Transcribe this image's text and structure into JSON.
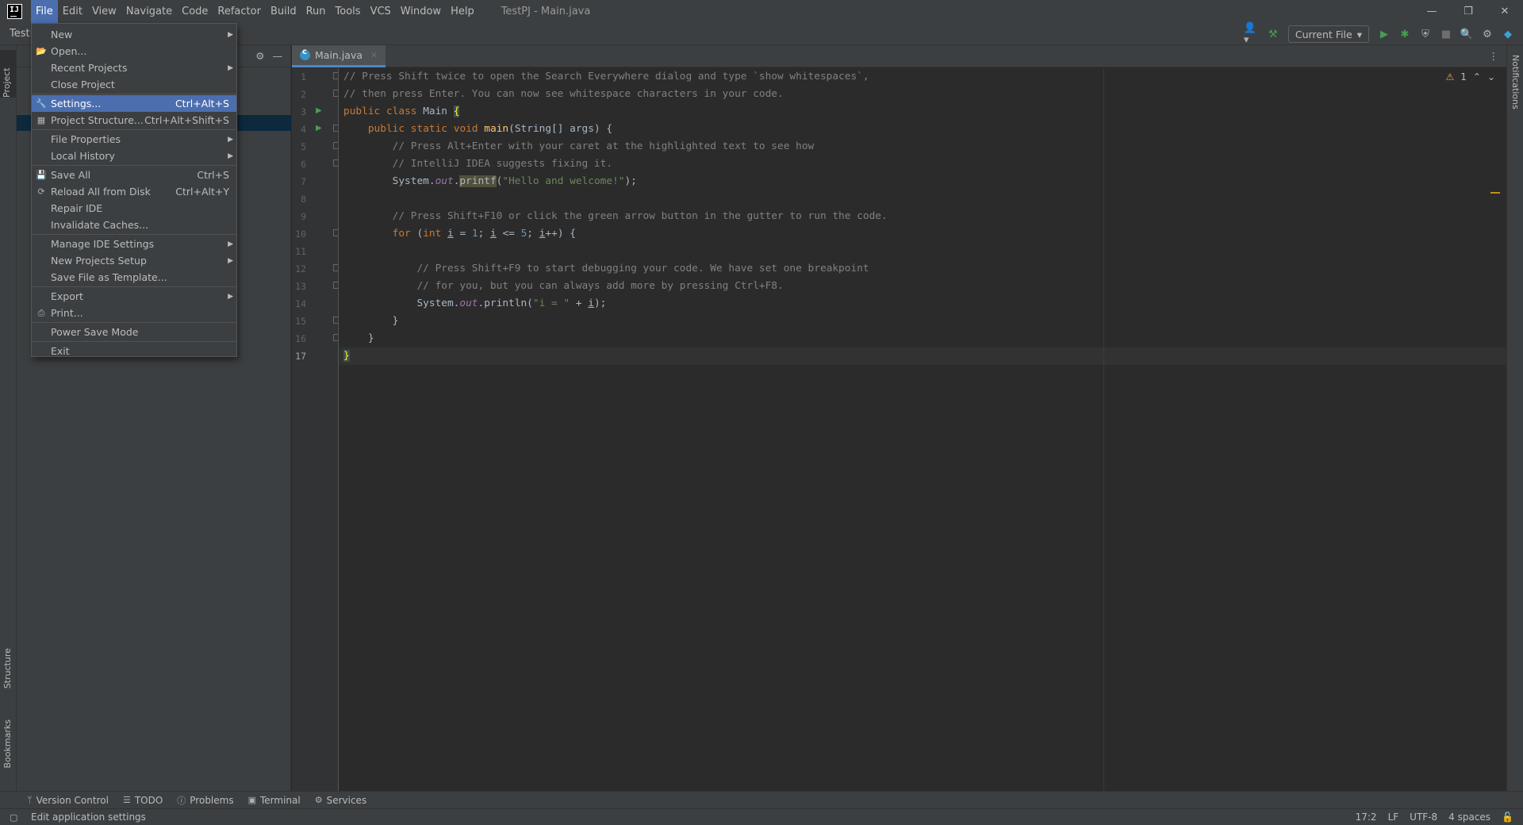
{
  "window": {
    "title": "TestPJ - Main.java",
    "minimize_icon": "minimize-icon",
    "restore_icon": "restore-icon",
    "close_icon": "close-icon"
  },
  "menubar": {
    "items": [
      "File",
      "Edit",
      "View",
      "Navigate",
      "Code",
      "Refactor",
      "Build",
      "Run",
      "Tools",
      "VCS",
      "Window",
      "Help"
    ],
    "active": "File"
  },
  "toolbar": {
    "project_crumb": "TestI",
    "run_config": "Current File"
  },
  "left_stripe": {
    "project": "Project",
    "structure": "Structure",
    "bookmarks": "Bookmarks"
  },
  "right_stripe": {
    "notifications": "Notifications"
  },
  "editor": {
    "tab": "Main.java",
    "warnings": "1",
    "current_line": 17,
    "line_numbers": [
      "1",
      "2",
      "3",
      "4",
      "5",
      "6",
      "7",
      "8",
      "9",
      "10",
      "11",
      "12",
      "13",
      "14",
      "15",
      "16",
      "17"
    ],
    "lines": [
      "// Press Shift twice to open the Search Everywhere dialog and type `show whitespaces`,",
      "// then press Enter. You can now see whitespace characters in your code.",
      "public class Main {",
      "    public static void main(String[] args) {",
      "        // Press Alt+Enter with your caret at the highlighted text to see how",
      "        // IntelliJ IDEA suggests fixing it.",
      "        System.out.printf(\"Hello and welcome!\");",
      "",
      "        // Press Shift+F10 or click the green arrow button in the gutter to run the code.",
      "        for (int i = 1; i <= 5; i++) {",
      "",
      "            // Press Shift+F9 to start debugging your code. We have set one breakpoint",
      "            // for you, but you can always add more by pressing Ctrl+F8.",
      "            System.out.println(\"i = \" + i);",
      "        }",
      "    }",
      "}"
    ]
  },
  "file_menu": {
    "items": [
      {
        "label": "New",
        "shortcut": "",
        "submenu": true,
        "icon": ""
      },
      {
        "label": "Open...",
        "shortcut": "",
        "submenu": false,
        "icon": "folder-icon"
      },
      {
        "label": "Recent Projects",
        "shortcut": "",
        "submenu": true,
        "icon": ""
      },
      {
        "label": "Close Project",
        "shortcut": "",
        "submenu": false,
        "icon": ""
      },
      {
        "label": "Settings...",
        "shortcut": "Ctrl+Alt+S",
        "submenu": false,
        "icon": "wrench-icon"
      },
      {
        "label": "Project Structure...",
        "shortcut": "Ctrl+Alt+Shift+S",
        "submenu": false,
        "icon": "project-structure-icon"
      },
      {
        "label": "File Properties",
        "shortcut": "",
        "submenu": true,
        "icon": ""
      },
      {
        "label": "Local History",
        "shortcut": "",
        "submenu": true,
        "icon": ""
      },
      {
        "label": "Save All",
        "shortcut": "Ctrl+S",
        "submenu": false,
        "icon": "save-icon"
      },
      {
        "label": "Reload All from Disk",
        "shortcut": "Ctrl+Alt+Y",
        "submenu": false,
        "icon": "reload-icon"
      },
      {
        "label": "Repair IDE",
        "shortcut": "",
        "submenu": false,
        "icon": ""
      },
      {
        "label": "Invalidate Caches...",
        "shortcut": "",
        "submenu": false,
        "icon": ""
      },
      {
        "label": "Manage IDE Settings",
        "shortcut": "",
        "submenu": true,
        "icon": ""
      },
      {
        "label": "New Projects Setup",
        "shortcut": "",
        "submenu": true,
        "icon": ""
      },
      {
        "label": "Save File as Template...",
        "shortcut": "",
        "submenu": false,
        "icon": ""
      },
      {
        "label": "Export",
        "shortcut": "",
        "submenu": true,
        "icon": ""
      },
      {
        "label": "Print...",
        "shortcut": "",
        "submenu": false,
        "icon": "print-icon"
      },
      {
        "label": "Power Save Mode",
        "shortcut": "",
        "submenu": false,
        "icon": ""
      },
      {
        "label": "Exit",
        "shortcut": "",
        "submenu": false,
        "icon": ""
      }
    ],
    "selected": "Settings..."
  },
  "bottom_tools": {
    "version_control": "Version Control",
    "todo": "TODO",
    "problems": "Problems",
    "terminal": "Terminal",
    "services": "Services"
  },
  "status": {
    "message": "Edit application settings",
    "position": "17:2",
    "line_sep": "LF",
    "encoding": "UTF-8",
    "indent": "4 spaces"
  },
  "colors": {
    "accent": "#4b6eaf",
    "background": "#2b2b2b",
    "panel": "#3c3f41"
  }
}
